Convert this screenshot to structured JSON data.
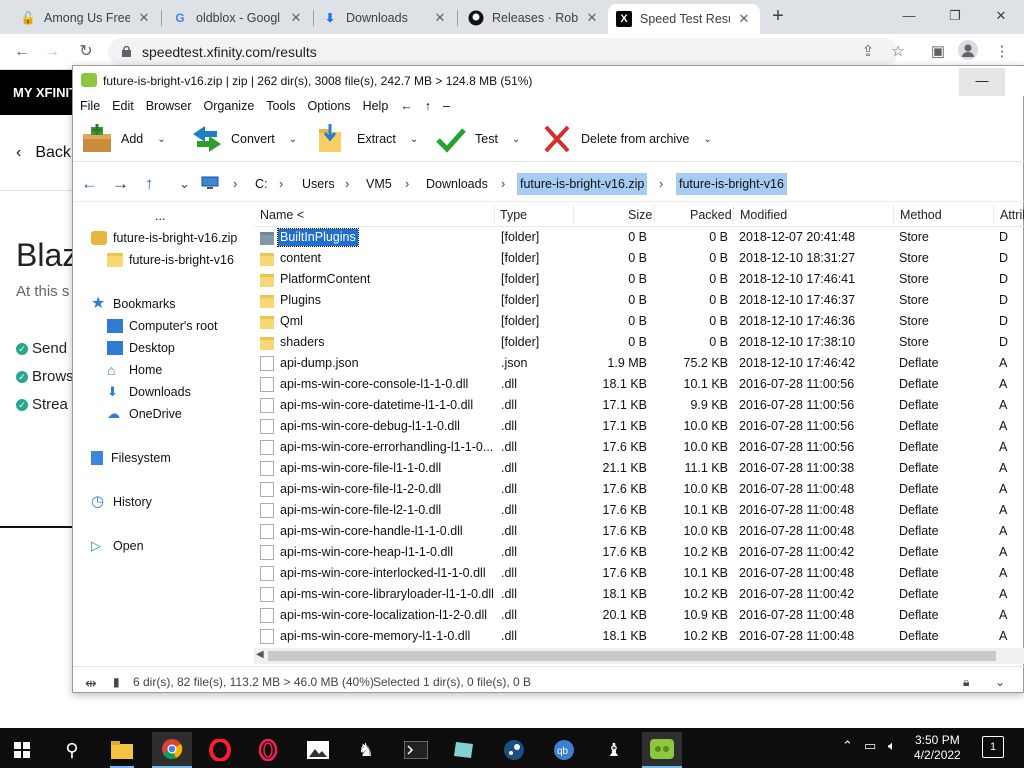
{
  "browser": {
    "tabs": [
      {
        "title": "Among Us Free",
        "icon": "padlock-red-icon"
      },
      {
        "title": "oldblox - Googl",
        "icon": "google-g-icon"
      },
      {
        "title": "Downloads",
        "icon": "download-arrow-icon"
      },
      {
        "title": "Releases · Roblo",
        "icon": "github-icon"
      },
      {
        "title": "Speed Test Resu",
        "icon": "x-logo-icon",
        "active": true
      }
    ],
    "url": "speedtest.xfinity.com/results"
  },
  "webpage": {
    "brand": "MY XFINITY",
    "back": "Back",
    "heading": "Blaz",
    "subtext": "At this s",
    "checks": [
      "Send",
      "Brows",
      "Strea"
    ]
  },
  "peazip": {
    "title": "future-is-bright-v16.zip | zip | 262 dir(s), 3008 file(s), 242.7 MB > 124.8 MB (51%)",
    "menu": [
      "File",
      "Edit",
      "Browser",
      "Organize",
      "Tools",
      "Options",
      "Help",
      "←",
      "↑",
      "–"
    ],
    "ribbon": {
      "add": "Add",
      "convert": "Convert",
      "extract": "Extract",
      "test": "Test",
      "delete": "Delete from archive"
    },
    "breadcrumbs": [
      "C:",
      "Users",
      "VM5",
      "Downloads",
      "future-is-bright-v16.zip",
      "future-is-bright-v16"
    ],
    "tree": {
      "more": "...",
      "archive": "future-is-bright-v16.zip",
      "archive_folder": "future-is-bright-v16",
      "bookmarks": "Bookmarks",
      "computer_root": "Computer's root",
      "desktop": "Desktop",
      "home": "Home",
      "downloads": "Downloads",
      "onedrive": "OneDrive",
      "filesystem": "Filesystem",
      "history": "History",
      "open": "Open"
    },
    "columns": {
      "name": "Name <",
      "type": "Type",
      "size": "Size",
      "packed": "Packed",
      "modified": "Modified",
      "method": "Method",
      "attrib": "Attrib"
    },
    "rows": [
      {
        "name": "BuiltInPlugins",
        "type": "[folder]",
        "size": "0 B",
        "packed": "0 B",
        "modified": "2018-12-07 20:41:48",
        "method": "Store",
        "attr": "D",
        "kind": "folder",
        "selected": true
      },
      {
        "name": "content",
        "type": "[folder]",
        "size": "0 B",
        "packed": "0 B",
        "modified": "2018-12-10 18:31:27",
        "method": "Store",
        "attr": "D",
        "kind": "folder"
      },
      {
        "name": "PlatformContent",
        "type": "[folder]",
        "size": "0 B",
        "packed": "0 B",
        "modified": "2018-12-10 17:46:41",
        "method": "Store",
        "attr": "D",
        "kind": "folder"
      },
      {
        "name": "Plugins",
        "type": "[folder]",
        "size": "0 B",
        "packed": "0 B",
        "modified": "2018-12-10 17:46:37",
        "method": "Store",
        "attr": "D",
        "kind": "folder"
      },
      {
        "name": "Qml",
        "type": "[folder]",
        "size": "0 B",
        "packed": "0 B",
        "modified": "2018-12-10 17:46:36",
        "method": "Store",
        "attr": "D",
        "kind": "folder"
      },
      {
        "name": "shaders",
        "type": "[folder]",
        "size": "0 B",
        "packed": "0 B",
        "modified": "2018-12-10 17:38:10",
        "method": "Store",
        "attr": "D",
        "kind": "folder"
      },
      {
        "name": "api-dump.json",
        "type": ".json",
        "size": "1.9 MB",
        "packed": "75.2 KB",
        "modified": "2018-12-10 17:46:42",
        "method": "Deflate",
        "attr": "A",
        "kind": "file"
      },
      {
        "name": "api-ms-win-core-console-l1-1-0.dll",
        "type": ".dll",
        "size": "18.1 KB",
        "packed": "10.1 KB",
        "modified": "2016-07-28 11:00:56",
        "method": "Deflate",
        "attr": "A",
        "kind": "file"
      },
      {
        "name": "api-ms-win-core-datetime-l1-1-0.dll",
        "type": ".dll",
        "size": "17.1 KB",
        "packed": "9.9 KB",
        "modified": "2016-07-28 11:00:56",
        "method": "Deflate",
        "attr": "A",
        "kind": "file"
      },
      {
        "name": "api-ms-win-core-debug-l1-1-0.dll",
        "type": ".dll",
        "size": "17.1 KB",
        "packed": "10.0 KB",
        "modified": "2016-07-28 11:00:56",
        "method": "Deflate",
        "attr": "A",
        "kind": "file"
      },
      {
        "name": "api-ms-win-core-errorhandling-l1-1-0...",
        "type": ".dll",
        "size": "17.6 KB",
        "packed": "10.0 KB",
        "modified": "2016-07-28 11:00:56",
        "method": "Deflate",
        "attr": "A",
        "kind": "file"
      },
      {
        "name": "api-ms-win-core-file-l1-1-0.dll",
        "type": ".dll",
        "size": "21.1 KB",
        "packed": "11.1 KB",
        "modified": "2016-07-28 11:00:38",
        "method": "Deflate",
        "attr": "A",
        "kind": "file"
      },
      {
        "name": "api-ms-win-core-file-l1-2-0.dll",
        "type": ".dll",
        "size": "17.6 KB",
        "packed": "10.0 KB",
        "modified": "2016-07-28 11:00:48",
        "method": "Deflate",
        "attr": "A",
        "kind": "file"
      },
      {
        "name": "api-ms-win-core-file-l2-1-0.dll",
        "type": ".dll",
        "size": "17.6 KB",
        "packed": "10.1 KB",
        "modified": "2016-07-28 11:00:48",
        "method": "Deflate",
        "attr": "A",
        "kind": "file"
      },
      {
        "name": "api-ms-win-core-handle-l1-1-0.dll",
        "type": ".dll",
        "size": "17.6 KB",
        "packed": "10.0 KB",
        "modified": "2016-07-28 11:00:48",
        "method": "Deflate",
        "attr": "A",
        "kind": "file"
      },
      {
        "name": "api-ms-win-core-heap-l1-1-0.dll",
        "type": ".dll",
        "size": "17.6 KB",
        "packed": "10.2 KB",
        "modified": "2016-07-28 11:00:42",
        "method": "Deflate",
        "attr": "A",
        "kind": "file"
      },
      {
        "name": "api-ms-win-core-interlocked-l1-1-0.dll",
        "type": ".dll",
        "size": "17.6 KB",
        "packed": "10.1 KB",
        "modified": "2016-07-28 11:00:48",
        "method": "Deflate",
        "attr": "A",
        "kind": "file"
      },
      {
        "name": "api-ms-win-core-libraryloader-l1-1-0.dll",
        "type": ".dll",
        "size": "18.1 KB",
        "packed": "10.2 KB",
        "modified": "2016-07-28 11:00:42",
        "method": "Deflate",
        "attr": "A",
        "kind": "file"
      },
      {
        "name": "api-ms-win-core-localization-l1-2-0.dll",
        "type": ".dll",
        "size": "20.1 KB",
        "packed": "10.9 KB",
        "modified": "2016-07-28 11:00:48",
        "method": "Deflate",
        "attr": "A",
        "kind": "file"
      },
      {
        "name": "api-ms-win-core-memory-l1-1-0.dll",
        "type": ".dll",
        "size": "18.1 KB",
        "packed": "10.2 KB",
        "modified": "2016-07-28 11:00:48",
        "method": "Deflate",
        "attr": "A",
        "kind": "file"
      }
    ],
    "status": {
      "left": "6 dir(s), 82 file(s), 113.2 MB > 46.0 MB (40%)",
      "right": "Selected 1 dir(s), 0 file(s), 0 B"
    }
  },
  "taskbar": {
    "time": "3:50 PM",
    "date": "4/2/2022",
    "notification_count": "1"
  }
}
